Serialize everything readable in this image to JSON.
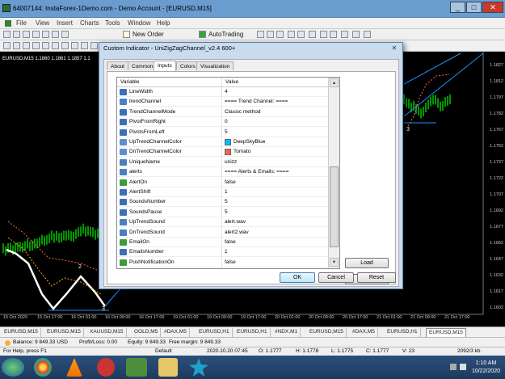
{
  "window": {
    "title": "64007144: InstaForex-1Demo.com - Demo Account - [EURUSD,M15]",
    "buttons": [
      "_",
      "□",
      "✕"
    ]
  },
  "menu": [
    "File",
    "View",
    "Insert",
    "Charts",
    "Tools",
    "Window",
    "Help"
  ],
  "toolbar": {
    "new_order": "New Order",
    "auto_trading": "AutoTrading"
  },
  "chart": {
    "symbol_info": "EURUSD,M15  1.1860 1.1861 1.1857 1.1",
    "y_labels": [
      "1.1827",
      "1.1812",
      "1.1797",
      "1.1782",
      "1.1767",
      "1.1752",
      "1.1737",
      "1.1722",
      "1.1707",
      "1.1692",
      "1.1677",
      "1.1662",
      "1.1647",
      "1.1632",
      "1.1617",
      "1.1602"
    ],
    "x_labels": [
      "15 Oct 2020",
      "15 Oct 17:00",
      "16 Oct 01:00",
      "16 Oct 09:00",
      "16 Oct 17:00",
      "19 Oct 01:00",
      "19 Oct 09:00",
      "19 Oct 17:00",
      "20 Oct 01:00",
      "20 Oct 09:00",
      "20 Oct 17:00",
      "21 Oct 01:00",
      "21 Oct 09:00",
      "21 Oct 17:00"
    ],
    "wave_labels": [
      "2",
      "3",
      "3"
    ]
  },
  "dialog": {
    "title": "Custom Indicator - UniZigZagChannel_v2.4 600+",
    "tabs": [
      "About",
      "Common",
      "Inputs",
      "Colors",
      "Visualization"
    ],
    "active_tab": "Inputs",
    "columns": [
      "Variable",
      "Value"
    ],
    "rows": [
      {
        "icon": "123",
        "name": "LineWidth",
        "value": "4"
      },
      {
        "icon": "ab",
        "name": "trendChannel",
        "value": "==== Trend Channel: ===="
      },
      {
        "icon": "123",
        "name": "TrendChannelMode",
        "value": "Classic method"
      },
      {
        "icon": "123",
        "name": "PivotFromRight",
        "value": "0"
      },
      {
        "icon": "123",
        "name": "PivotsFromLeft",
        "value": "5"
      },
      {
        "icon": "color",
        "name": "UpTrendChannelColor",
        "value": "DeepSkyBlue",
        "swatch": "#00bfff"
      },
      {
        "icon": "color",
        "name": "DnTrendChannelColor",
        "value": "Tomato",
        "swatch": "#ff6347"
      },
      {
        "icon": "ab",
        "name": "UniqueName",
        "value": "unizz"
      },
      {
        "icon": "ab",
        "name": "alerts",
        "value": "==== Alerts & Emails: ===="
      },
      {
        "icon": "bool",
        "name": "AlertOn",
        "value": "false"
      },
      {
        "icon": "123",
        "name": "AlertShift",
        "value": "1"
      },
      {
        "icon": "123",
        "name": "SoundsNumber",
        "value": "5"
      },
      {
        "icon": "123",
        "name": "SoundsPause",
        "value": "5"
      },
      {
        "icon": "ab",
        "name": "UpTrendSound",
        "value": "alert.wav"
      },
      {
        "icon": "ab",
        "name": "DnTrendSound",
        "value": "alert2.wav"
      },
      {
        "icon": "bool",
        "name": "EmailOn",
        "value": "false"
      },
      {
        "icon": "123",
        "name": "EmailsNumber",
        "value": "1"
      },
      {
        "icon": "bool",
        "name": "PushNotificationOn",
        "value": "false"
      }
    ],
    "load_label": "Load",
    "save_label": "Save",
    "ok_label": "OK",
    "cancel_label": "Cancel",
    "reset_label": "Reset"
  },
  "chart_tabs": [
    "EURUSD,M15",
    "EURUSD,M15",
    "XAUUSD,M15",
    "GOLD,M5",
    "#DAX,M5",
    "EURUSD,H1",
    "EURUSD,H1",
    "#NDX,M1",
    "EURUSD,M15",
    "#DAX,M5",
    "EURUSD,H1",
    "EURUSD,M15"
  ],
  "active_chart_tab": 11,
  "terminal": {
    "balance": "Balance: 9 849.33 USD",
    "profit": "Profit/Loss: 0.00",
    "equity": "Equity: 9 849.33",
    "free_margin": "Free margin: 9 849.33"
  },
  "status": {
    "help": "For Help, press F1",
    "profile": "Default",
    "datetime": "2020.10.20 07:45",
    "o": "O: 1.1777",
    "h": "H: 1.1778",
    "l": "L: 1.1775",
    "c": "C: 1.1777",
    "v": "V: 23",
    "traffic": "2092/3 kb"
  },
  "clock": {
    "time": "1:10 AM",
    "date": "10/22/2020"
  },
  "colors": {
    "up": "#00bfff",
    "dn": "#ff6347",
    "candle_green": "#00c800",
    "channel": "#1e90ff"
  }
}
